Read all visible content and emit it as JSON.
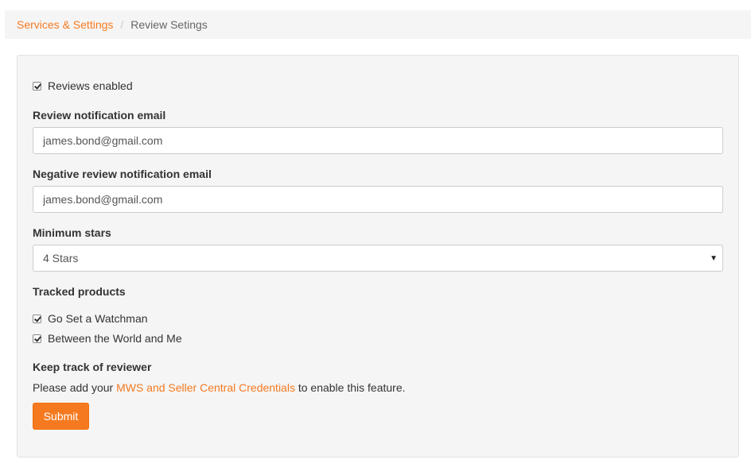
{
  "breadcrumb": {
    "parent": "Services & Settings",
    "separator": "/",
    "current": "Review Setings"
  },
  "form": {
    "reviews_enabled": {
      "label": "Reviews enabled",
      "checked": true
    },
    "review_email": {
      "label": "Review notification email",
      "value": "james.bond@gmail.com"
    },
    "negative_email": {
      "label": "Negative review notification email",
      "value": "james.bond@gmail.com"
    },
    "min_stars": {
      "label": "Minimum stars",
      "selected": "4 Stars"
    },
    "tracked_products": {
      "label": "Tracked products",
      "items": [
        {
          "label": "Go Set a Watchman",
          "checked": true
        },
        {
          "label": "Between the World and Me",
          "checked": true
        }
      ]
    },
    "reviewer": {
      "label": "Keep track of reviewer",
      "text_before": "Please add your ",
      "link_text": "MWS and Seller Central Credentials",
      "text_after": " to enable this feature."
    },
    "submit_label": "Submit"
  },
  "colors": {
    "accent": "#f57a1f",
    "panel_bg": "#f5f5f5"
  }
}
